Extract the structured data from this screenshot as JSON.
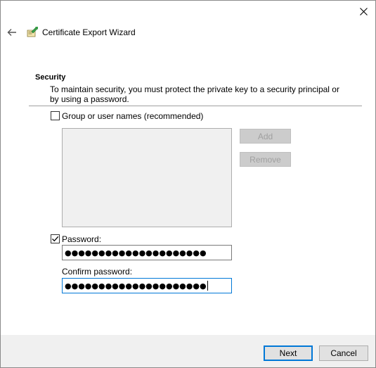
{
  "window": {
    "title": "Certificate Export Wizard"
  },
  "section": {
    "title": "Security",
    "description": "To maintain security, you must protect the private key to a security principal or by using a password."
  },
  "group_option": {
    "label": "Group or user names (recommended)",
    "checked": false
  },
  "buttons": {
    "add": "Add",
    "remove": "Remove",
    "next": "Next",
    "cancel": "Cancel"
  },
  "password_option": {
    "label": "Password:",
    "checked": true,
    "masked_value": "●●●●●●●●●●●●●●●●●●●●●"
  },
  "confirm_password": {
    "label": "Confirm password:",
    "masked_value": "●●●●●●●●●●●●●●●●●●●●●"
  },
  "icons": {
    "close": "close-icon",
    "back": "back-arrow-icon",
    "wizard": "certificate-icon",
    "checkmark": "checkmark-icon"
  },
  "colors": {
    "accent": "#0078d7",
    "window_bg": "#f0f0f0",
    "content_bg": "#ffffff"
  }
}
